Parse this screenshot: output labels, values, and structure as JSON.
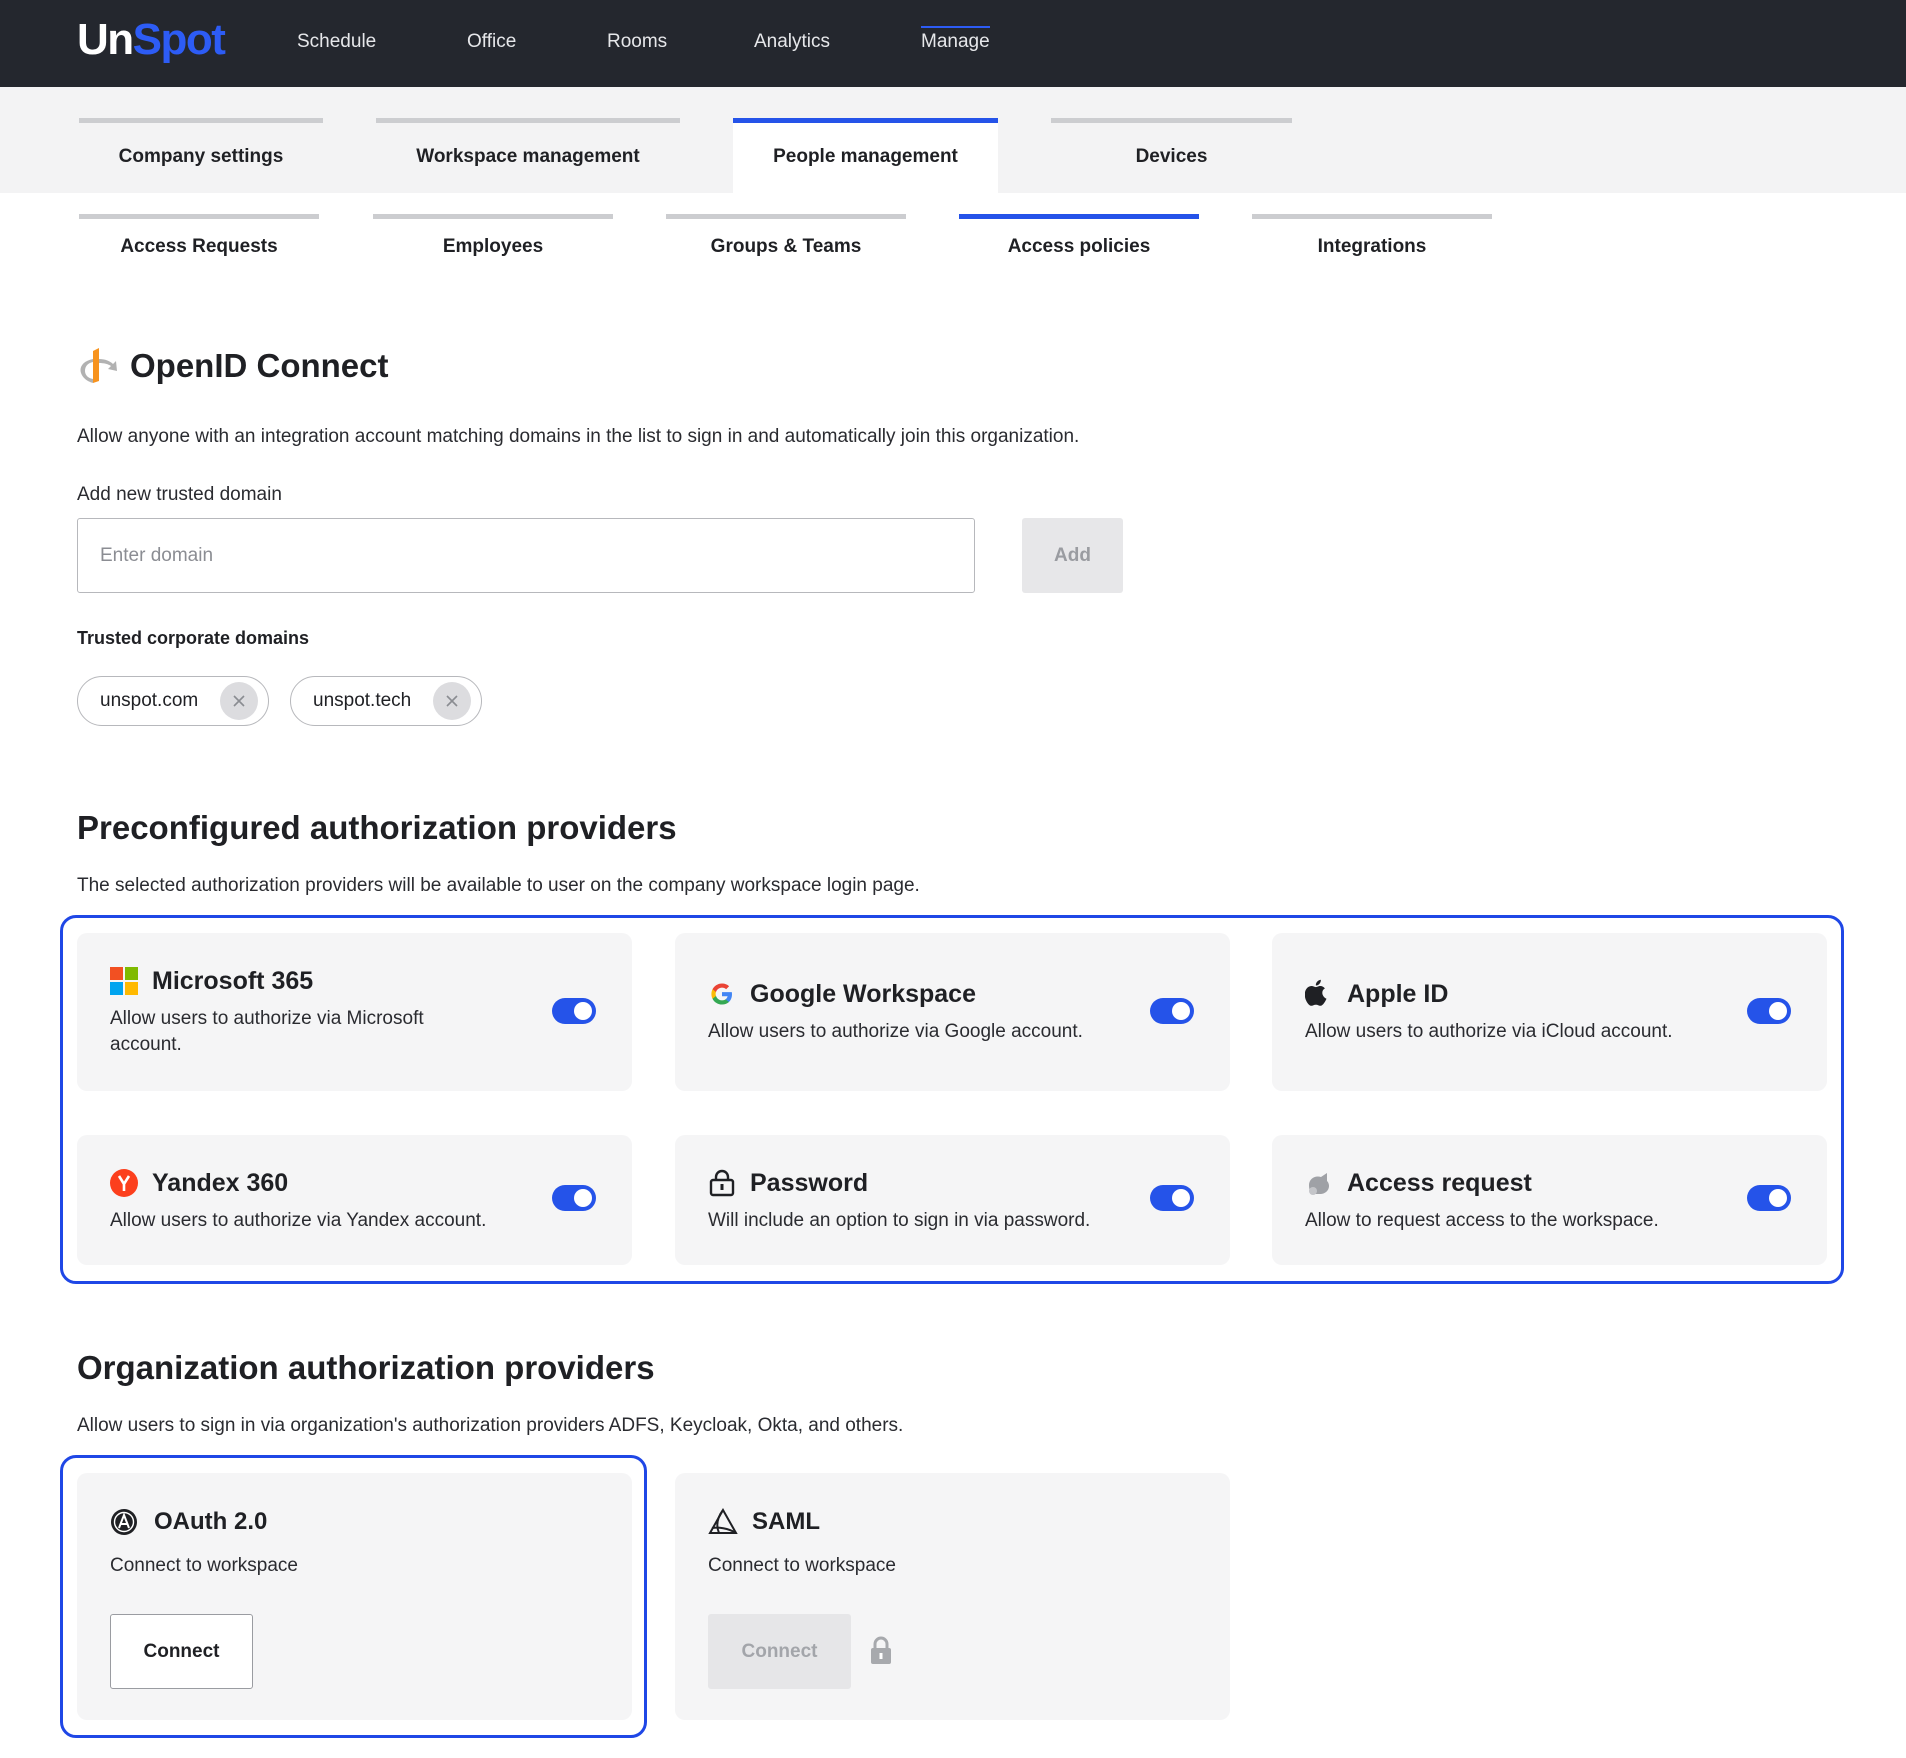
{
  "app": {
    "logo_prefix": "Un",
    "logo_suffix": "Spot"
  },
  "nav": [
    "Schedule",
    "Office",
    "Rooms",
    "Analytics",
    "Manage"
  ],
  "tabs": [
    "Company settings",
    "Workspace management",
    "People management",
    "Devices"
  ],
  "subtabs": [
    "Access Requests",
    "Employees",
    "Groups & Teams",
    "Access policies",
    "Integrations"
  ],
  "openid": {
    "title": "OpenID Connect",
    "description": "Allow anyone with an integration account matching domains in the list to sign in and automatically join this organization.",
    "add_label": "Add new trusted domain",
    "input_placeholder": "Enter domain",
    "input_value": "",
    "add_button": "Add",
    "trusted_label": "Trusted corporate domains",
    "domains": [
      "unspot.com",
      "unspot.tech"
    ]
  },
  "preconfigured": {
    "title": "Preconfigured authorization providers",
    "description": "The selected authorization providers will be available to user on the company workspace login page.",
    "providers": [
      {
        "name": "Microsoft 365",
        "desc": "Allow users to authorize via Microsoft account.",
        "icon": "microsoft-icon",
        "enabled": true
      },
      {
        "name": "Google Workspace",
        "desc": "Allow users to authorize via Google account.",
        "icon": "google-icon",
        "enabled": true
      },
      {
        "name": "Apple ID",
        "desc": "Allow users to authorize via iCloud account.",
        "icon": "apple-icon",
        "enabled": true
      },
      {
        "name": "Yandex 360",
        "desc": "Allow users to authorize via Yandex account.",
        "icon": "yandex-icon",
        "enabled": true
      },
      {
        "name": "Password",
        "desc": "Will include an option to sign in via password.",
        "icon": "lock-icon",
        "enabled": true
      },
      {
        "name": "Access request",
        "desc": "Allow to request access to the workspace.",
        "icon": "access-request-icon",
        "enabled": true
      }
    ]
  },
  "organization": {
    "title": "Organization authorization providers",
    "description": "Allow users to sign in via organization's authorization providers ADFS, Keycloak, Okta, and others.",
    "providers": [
      {
        "name": "OAuth 2.0",
        "desc": "Connect to workspace",
        "button": "Connect",
        "icon": "oauth-icon",
        "locked": false
      },
      {
        "name": "SAML",
        "desc": "Connect to workspace",
        "button": "Connect",
        "icon": "saml-icon",
        "locked": true
      }
    ]
  },
  "colors": {
    "accent": "#2553e9",
    "topbar": "#24272e",
    "card": "#f5f5f6",
    "highlight_frame": "#1f47e6"
  }
}
